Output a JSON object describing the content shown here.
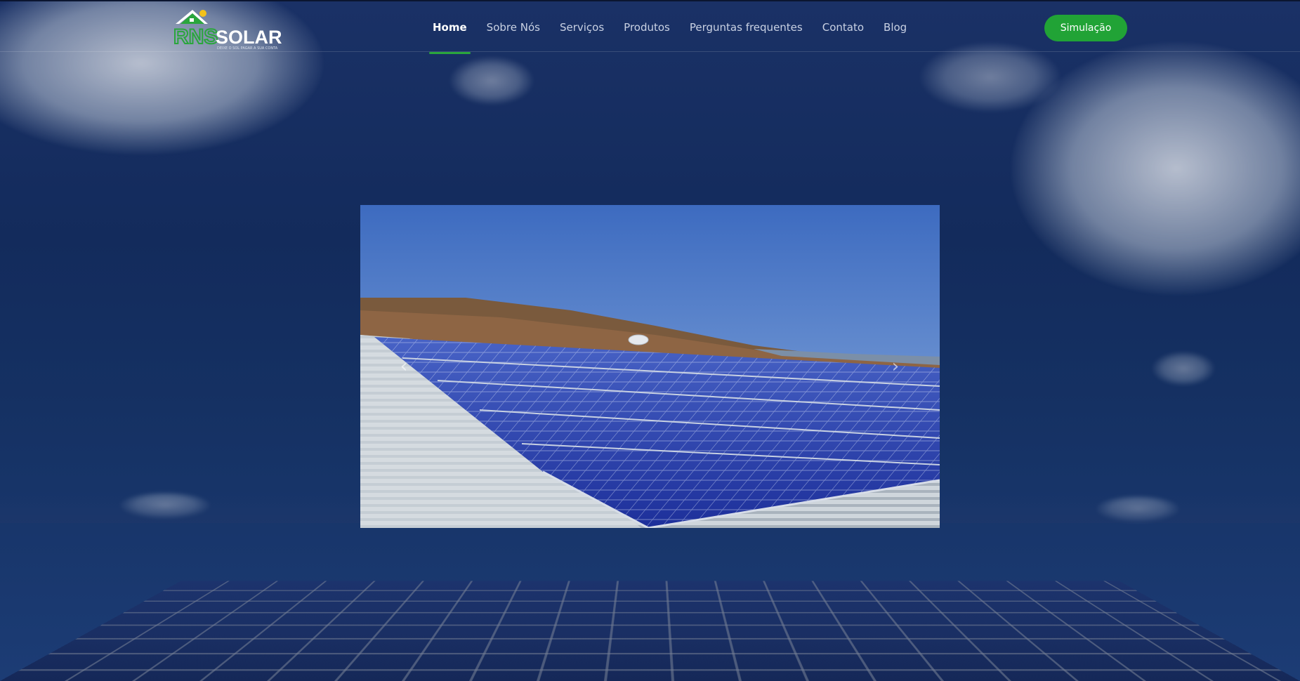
{
  "header": {
    "logo": {
      "brand_initials": "RNS",
      "brand_word": "SOLAR",
      "tagline": "DEIXE O SOL PAGAR A SUA CONTA"
    },
    "nav": [
      {
        "label": "Home",
        "active": true
      },
      {
        "label": "Sobre Nós",
        "active": false
      },
      {
        "label": "Serviços",
        "active": false
      },
      {
        "label": "Produtos",
        "active": false
      },
      {
        "label": "Perguntas frequentes",
        "active": false
      },
      {
        "label": "Contato",
        "active": false
      },
      {
        "label": "Blog",
        "active": false
      }
    ],
    "cta_label": "Simulação"
  },
  "carousel": {
    "prev_icon": "chevron-left-icon",
    "next_icon": "chevron-right-icon"
  },
  "colors": {
    "accent_green": "#21a336",
    "nav_active_underline": "#2aa63c",
    "header_text": "#c9d1e3",
    "background_navy": "#132b5c"
  }
}
